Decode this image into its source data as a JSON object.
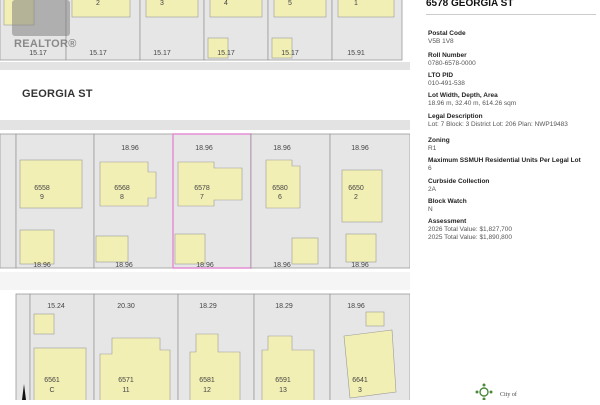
{
  "panel": {
    "title": "6578 GEORGIA ST",
    "fields": [
      {
        "label": "Postal Code",
        "values": [
          "V5B 1V8"
        ]
      },
      {
        "label": "Roll Number",
        "values": [
          "0780-6578-0000"
        ]
      },
      {
        "label": "LTO PID",
        "values": [
          "010-491-538"
        ]
      },
      {
        "label": "Lot Width, Depth, Area",
        "values": [
          "18.96 m, 32.40 m, 614.26 sqm"
        ]
      },
      {
        "label": "Legal Description",
        "values": [
          "Lot: 7 Block: 3 District Lot: 206 Plan: NWP19483"
        ]
      },
      {
        "label": "Zoning",
        "values": [
          "R1"
        ]
      },
      {
        "label": "Maximum SSMUH Residential Units Per Legal Lot",
        "values": [
          "6"
        ]
      },
      {
        "label": "Curbside Collection",
        "values": [
          "2A"
        ]
      },
      {
        "label": "Block Watch",
        "values": [
          "N"
        ]
      },
      {
        "label": "Assessment",
        "values": [
          "2026 Total Value: $1,827,700",
          "2025 Total Value: $1,890,800"
        ]
      }
    ],
    "logo_text": "City of"
  },
  "watermark": {
    "text": "REALTOR®"
  },
  "map": {
    "street_name": "GEORGIA ST",
    "selected_color": "#e58fd4",
    "top_row": [
      {
        "lot": "2",
        "frontage": "15.17"
      },
      {
        "lot": "3",
        "frontage": "15.17"
      },
      {
        "lot": "4",
        "frontage": "15.17"
      },
      {
        "lot": "5",
        "frontage": "15.17"
      },
      {
        "lot": "1",
        "frontage": "15.91"
      }
    ],
    "top_row_partial_left": "15.17",
    "middle_row": [
      {
        "address": "6558",
        "lot": "9",
        "front": "",
        "back": "18.96"
      },
      {
        "address": "6568",
        "lot": "8",
        "front": "18.96",
        "back": "18.96"
      },
      {
        "address": "6578",
        "lot": "7",
        "front": "18.96",
        "back": "18.96",
        "selected": true
      },
      {
        "address": "6580",
        "lot": "6",
        "front": "18.96",
        "back": "18.96"
      },
      {
        "address": "6650",
        "lot": "2",
        "front": "18.96",
        "back": "18.96"
      }
    ],
    "middle_row_partial_left": "18.96",
    "bottom_row": [
      {
        "address": "6561",
        "lot": "C",
        "front": "15.24"
      },
      {
        "address": "6571",
        "lot": "11",
        "front": "20.30"
      },
      {
        "address": "6581",
        "lot": "12",
        "front": "18.29"
      },
      {
        "address": "6591",
        "lot": "13",
        "front": "18.29"
      },
      {
        "address": "6641",
        "lot": "3",
        "front": "18.96"
      }
    ]
  }
}
